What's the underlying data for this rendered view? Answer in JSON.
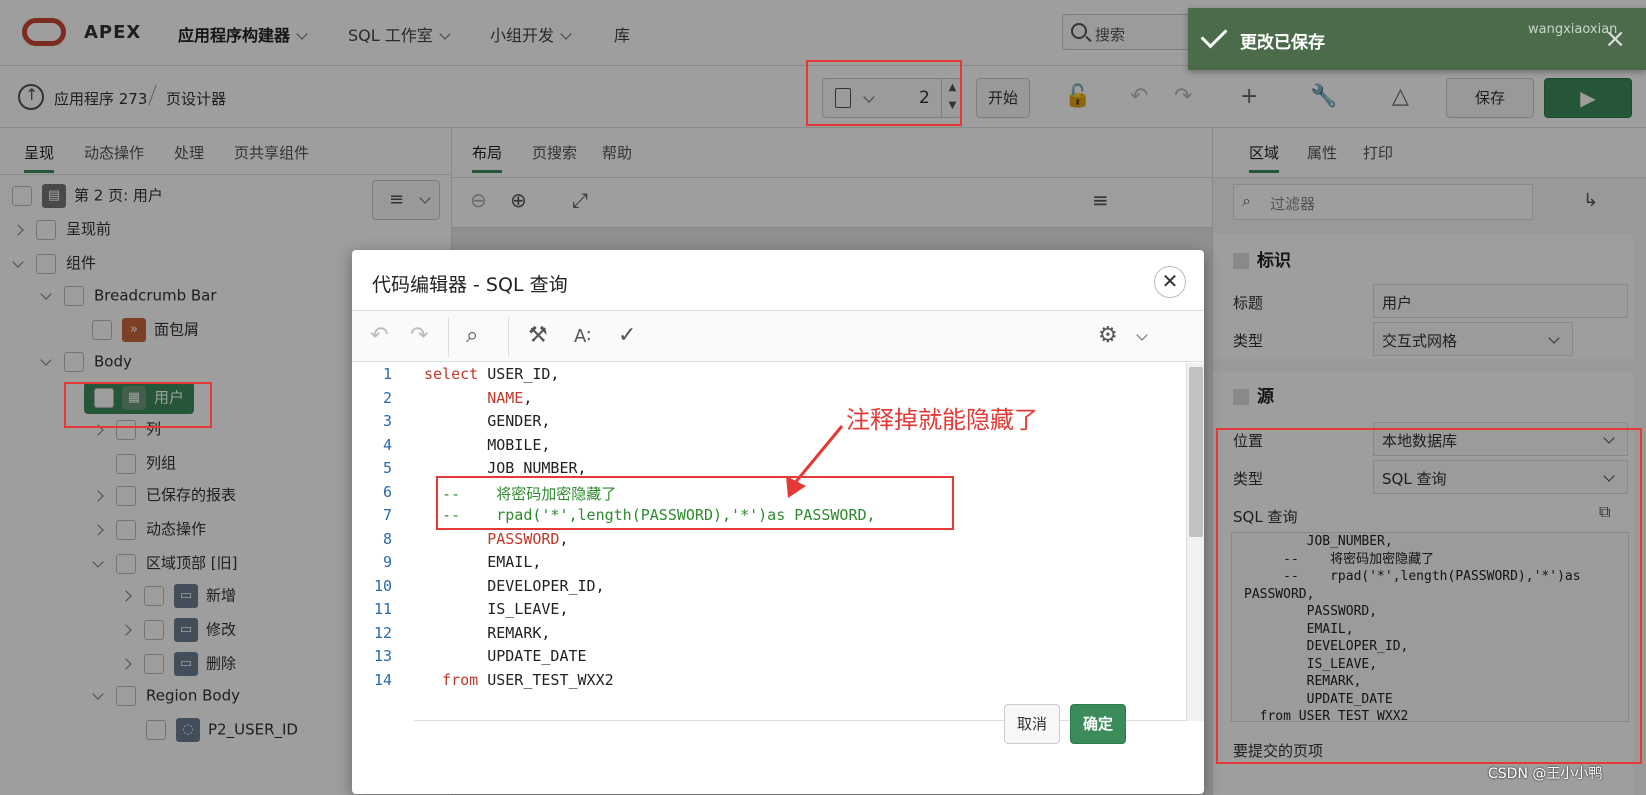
{
  "header": {
    "brand": "APEX",
    "nav": [
      {
        "label": "应用程序构建器"
      },
      {
        "label": "SQL 工作室"
      },
      {
        "label": "小组开发"
      },
      {
        "label": "库"
      }
    ],
    "search_placeholder": "搜索",
    "toast": "更改已保存",
    "user": "wangxiaoxian"
  },
  "toolbar": {
    "crumb_app": "应用程序 273",
    "crumb_page": "页设计器",
    "page_number": "2",
    "start_label": "开始",
    "save_label": "保存"
  },
  "left": {
    "tabs": [
      "呈现",
      "动态操作",
      "处理",
      "页共享组件"
    ],
    "tree": [
      "第 2 页: 用户",
      "呈现前",
      "组件",
      "Breadcrumb Bar",
      "面包屑",
      "Body",
      "用户",
      "列",
      "列组",
      "已保存的报表",
      "动态操作",
      "区域顶部 [旧]",
      "新增",
      "修改",
      "删除",
      "Region Body",
      "P2_USER_ID"
    ]
  },
  "middle": {
    "tabs": [
      "布局",
      "页搜索",
      "帮助"
    ]
  },
  "right": {
    "tabs": [
      "区域",
      "属性",
      "打印"
    ],
    "filter_placeholder": "过滤器",
    "ident_title": "标识",
    "title_label": "标题",
    "title_value": "用户",
    "type_label": "类型",
    "type_value": "交互式网格",
    "source_title": "源",
    "location_label": "位置",
    "location_value": "本地数据库",
    "stype_label": "类型",
    "stype_value": "SQL 查询",
    "sql_label": "SQL 查询",
    "sql_text": "        JOB_NUMBER,\n     --    将密码加密隐藏了\n     --    rpad('*',length(PASSWORD),'*')as\nPASSWORD,\n        PASSWORD,\n        EMAIL,\n        DEVELOPER_ID,\n        IS_LEAVE,\n        REMARK,\n        UPDATE_DATE\n  from USER_TEST_WXX2",
    "submit_label": "要提交的页项"
  },
  "dialog": {
    "title": "代码编辑器 - SQL 查询",
    "cancel": "取消",
    "ok": "确定",
    "code_lines": [
      {
        "n": "1",
        "parts": [
          {
            "c": "kw",
            "t": "select"
          },
          {
            "c": "",
            "t": " USER_ID,"
          }
        ]
      },
      {
        "n": "2",
        "parts": [
          {
            "c": "",
            "t": "       "
          },
          {
            "c": "col",
            "t": "NAME"
          },
          {
            "c": "",
            "t": ","
          }
        ]
      },
      {
        "n": "3",
        "parts": [
          {
            "c": "",
            "t": "       GENDER,"
          }
        ]
      },
      {
        "n": "4",
        "parts": [
          {
            "c": "",
            "t": "       MOBILE,"
          }
        ]
      },
      {
        "n": "5",
        "parts": [
          {
            "c": "",
            "t": "       JOB_NUMBER,"
          }
        ]
      },
      {
        "n": "6",
        "parts": [
          {
            "c": "cm",
            "t": "  --    将密码加密隐藏了"
          }
        ]
      },
      {
        "n": "7",
        "parts": [
          {
            "c": "cm",
            "t": "  --    rpad('*',length(PASSWORD),'*')as PASSWORD,"
          }
        ]
      },
      {
        "n": "8",
        "parts": [
          {
            "c": "",
            "t": "       "
          },
          {
            "c": "col",
            "t": "PASSWORD"
          },
          {
            "c": "",
            "t": ","
          }
        ]
      },
      {
        "n": "9",
        "parts": [
          {
            "c": "",
            "t": "       EMAIL,"
          }
        ]
      },
      {
        "n": "10",
        "parts": [
          {
            "c": "",
            "t": "       DEVELOPER_ID,"
          }
        ]
      },
      {
        "n": "11",
        "parts": [
          {
            "c": "",
            "t": "       IS_LEAVE,"
          }
        ]
      },
      {
        "n": "12",
        "parts": [
          {
            "c": "",
            "t": "       REMARK,"
          }
        ]
      },
      {
        "n": "13",
        "parts": [
          {
            "c": "",
            "t": "       UPDATE_DATE"
          }
        ]
      },
      {
        "n": "14",
        "parts": [
          {
            "c": "kw",
            "t": "  from"
          },
          {
            "c": "",
            "t": " USER_TEST_WXX2"
          }
        ]
      }
    ]
  },
  "annotation": "注释掉就能隐藏了",
  "watermark": "CSDN @王小小鸭"
}
